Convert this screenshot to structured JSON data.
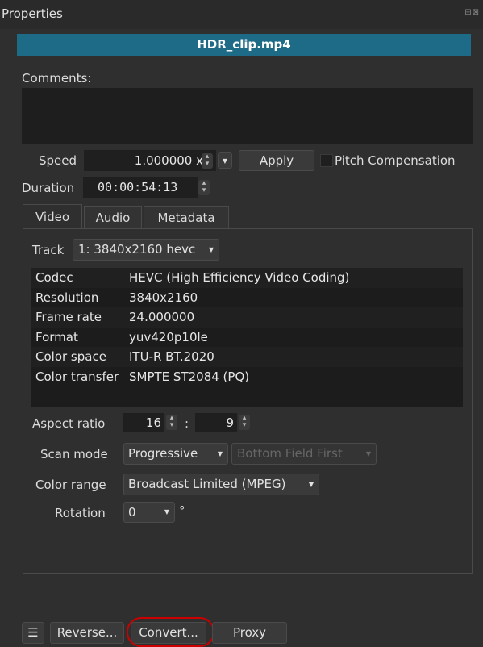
{
  "window": {
    "title": "Properties",
    "title_icons": "⊞⊠"
  },
  "file": {
    "name": "HDR_clip.mp4"
  },
  "comments": {
    "label": "Comments:"
  },
  "speed": {
    "label": "Speed",
    "value": "1.000000 x",
    "apply": "Apply",
    "pitch_label": "Pitch Compensation"
  },
  "duration": {
    "label": "Duration",
    "value": "00:00:54:13"
  },
  "tabs": [
    {
      "label": "Video"
    },
    {
      "label": "Audio"
    },
    {
      "label": "Metadata"
    }
  ],
  "track": {
    "label": "Track",
    "value": "1: 3840x2160 hevc"
  },
  "info": [
    {
      "key": "Codec",
      "value": "HEVC (High Efficiency Video Coding)"
    },
    {
      "key": "Resolution",
      "value": "3840x2160"
    },
    {
      "key": "Frame rate",
      "value": "24.000000"
    },
    {
      "key": "Format",
      "value": "yuv420p10le"
    },
    {
      "key": "Color space",
      "value": "ITU-R BT.2020"
    },
    {
      "key": "Color transfer",
      "value": "SMPTE ST2084 (PQ)"
    }
  ],
  "aspect": {
    "label": "Aspect ratio",
    "num": "16",
    "sep": ":",
    "den": "9"
  },
  "scan": {
    "label": "Scan mode",
    "value": "Progressive",
    "field": "Bottom Field First"
  },
  "color_range": {
    "label": "Color range",
    "value": "Broadcast Limited (MPEG)"
  },
  "rotation": {
    "label": "Rotation",
    "value": "0",
    "unit": "°"
  },
  "bottom": {
    "menu": "☰",
    "reverse": "Reverse...",
    "convert": "Convert...",
    "proxy": "Proxy"
  },
  "colors": {
    "accent": "#1e6b87",
    "highlight": "#cc0000"
  }
}
